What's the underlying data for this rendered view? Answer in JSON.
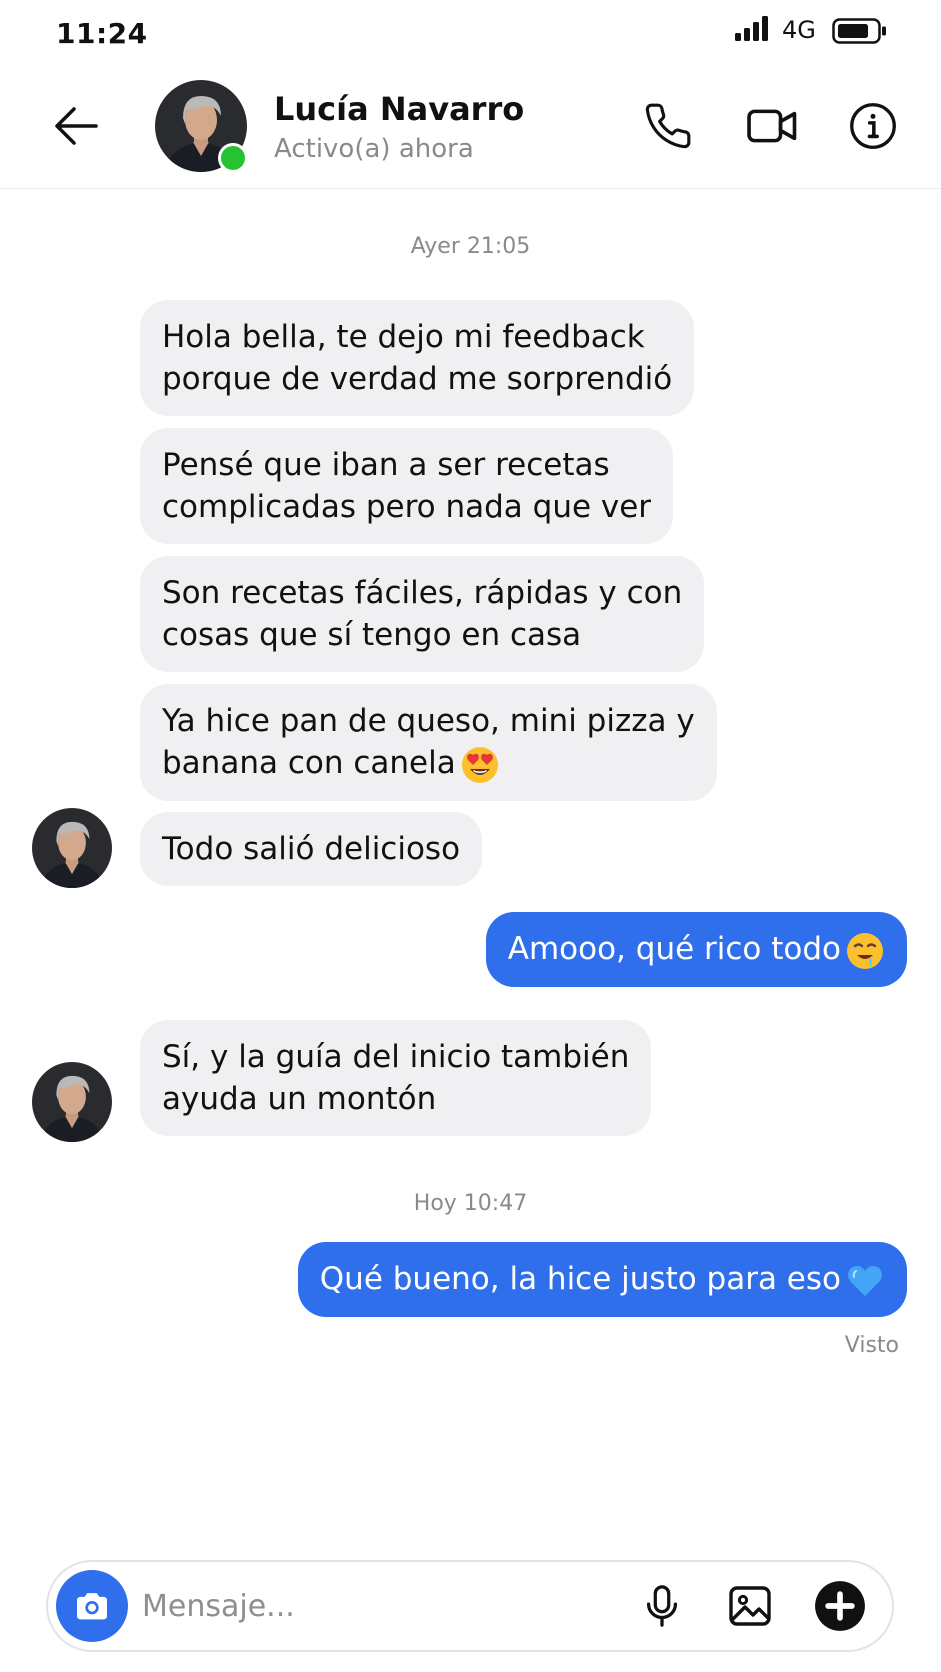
{
  "status_bar": {
    "time": "11:24",
    "network": "4G"
  },
  "header": {
    "contact_name": "Lucía Navarro",
    "contact_status": "Activo(a) ahora",
    "online_color": "#26c22f",
    "icons": [
      "arrow-left-icon",
      "phone-icon",
      "video-camera-icon",
      "info-icon"
    ]
  },
  "chat": {
    "timestamps": [
      "Ayer 21:05",
      "Hoy 10:47"
    ],
    "messages": [
      {
        "from": "contact",
        "lines": [
          "Hola bella, te dejo mi feedback",
          "porque de verdad me sorprendió"
        ]
      },
      {
        "from": "contact",
        "lines": [
          "Pensé que iban a ser recetas",
          "complicadas pero nada que ver"
        ]
      },
      {
        "from": "contact",
        "lines": [
          "Son recetas fáciles, rápidas y con",
          "cosas que sí tengo en casa"
        ]
      },
      {
        "from": "contact",
        "lines": [
          "Ya hice pan de queso, mini pizza y",
          "banana con canela"
        ],
        "emoji": "heart-eyes-emoji"
      },
      {
        "from": "contact",
        "lines": [
          "Todo salió delicioso"
        ]
      },
      {
        "from": "me",
        "lines": [
          "Amooo, qué rico todo"
        ],
        "emoji": "drooling-face-emoji"
      },
      {
        "from": "contact",
        "lines": [
          "Sí, y la guía del inicio también",
          "ayuda un montón"
        ]
      },
      {
        "from": "me",
        "lines": [
          "Qué bueno, la hice justo para eso"
        ],
        "emoji": "blue-heart-emoji"
      }
    ],
    "seen_label": "Visto",
    "incoming_bubble_color": "#f0f0f2",
    "outgoing_bubble_color": "#2f6fec"
  },
  "composer": {
    "placeholder": "Mensaje...",
    "icons": [
      "camera-icon",
      "microphone-icon",
      "image-icon",
      "plus-icon"
    ]
  }
}
